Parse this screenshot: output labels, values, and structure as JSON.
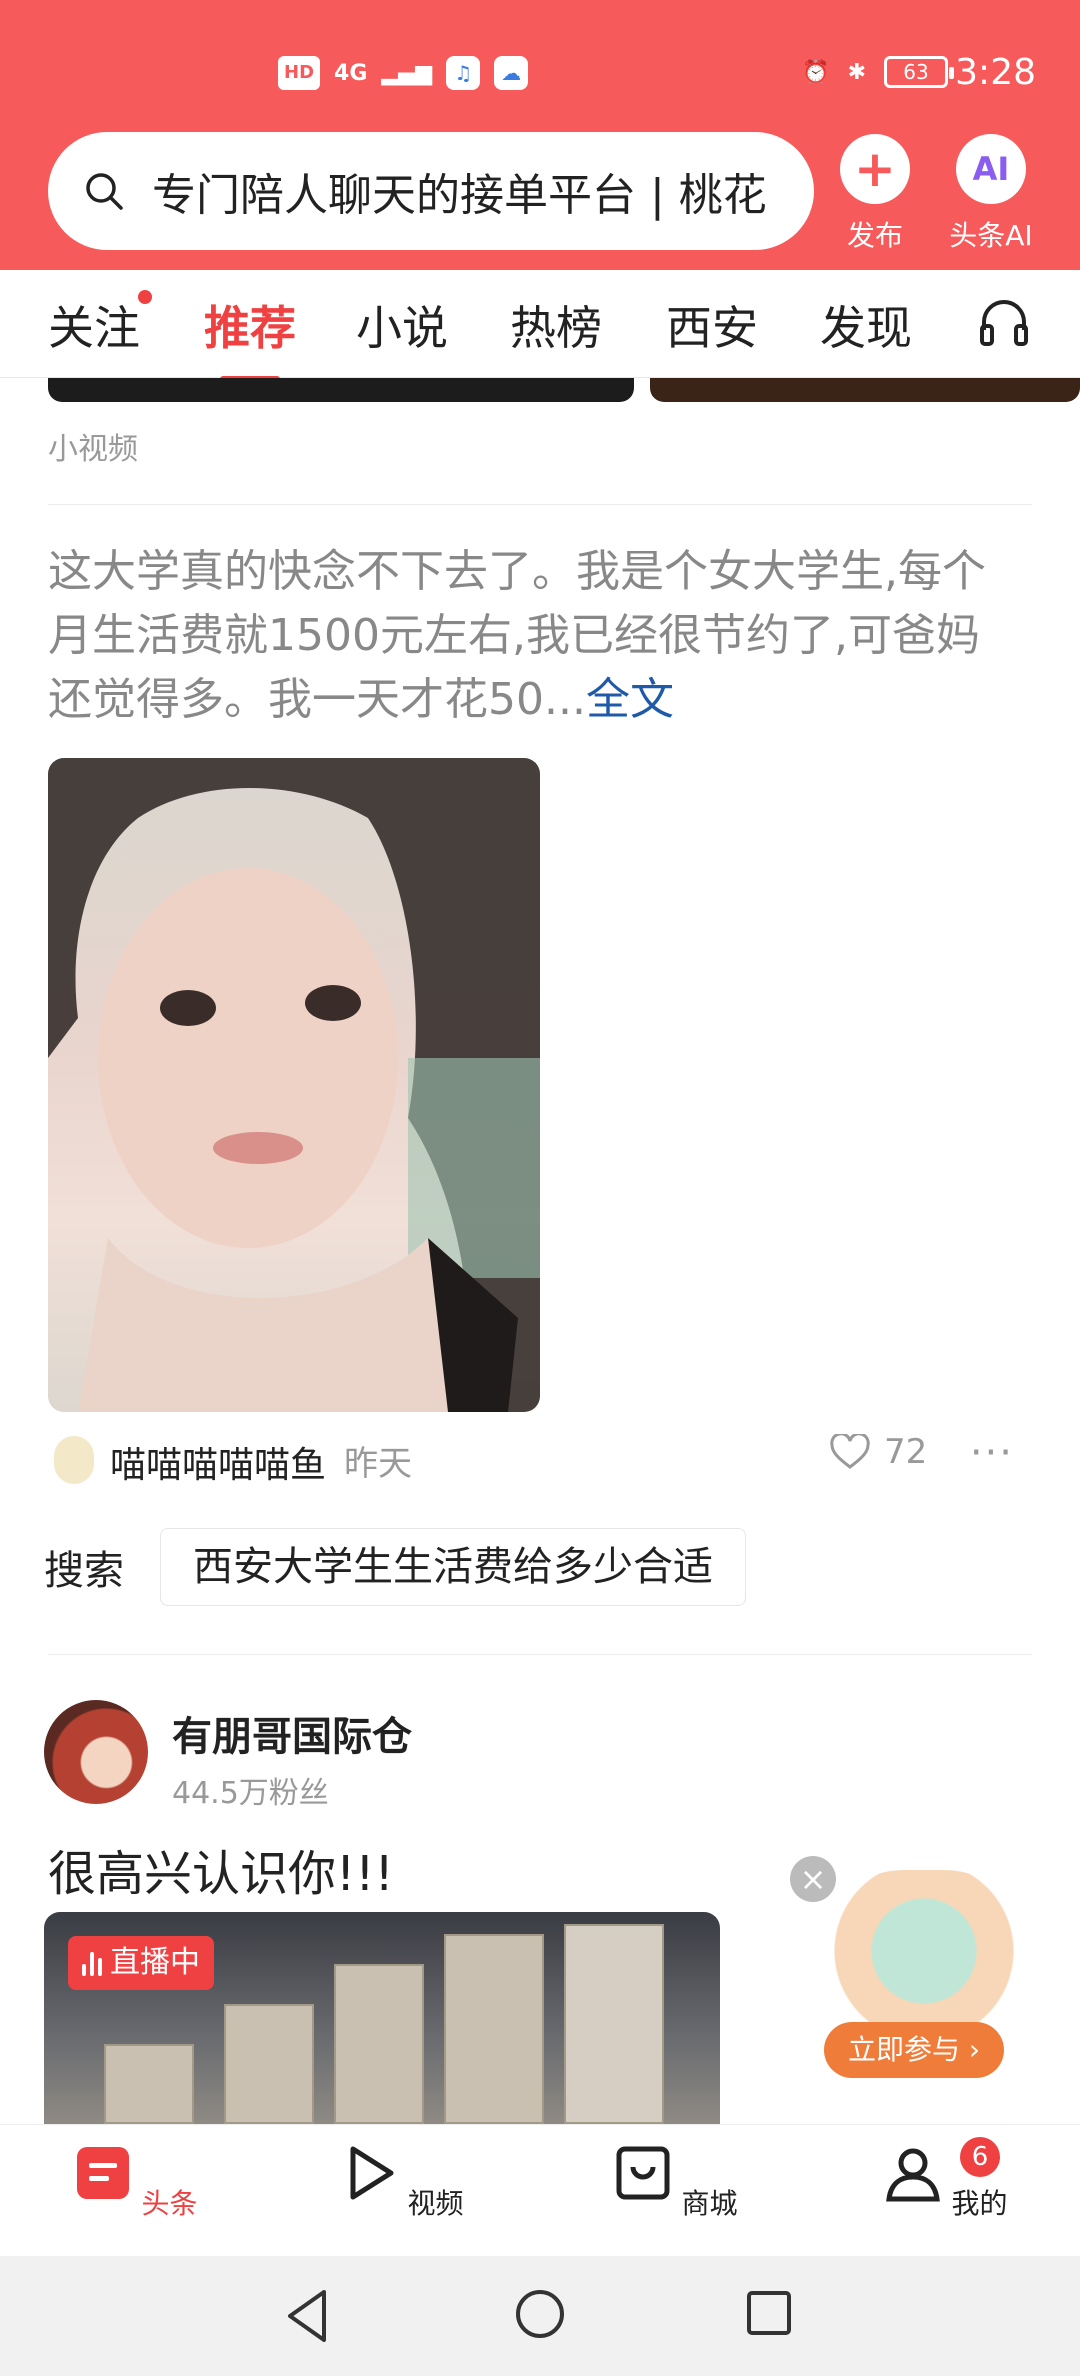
{
  "status_bar": {
    "time": "3:28",
    "battery": "63",
    "network": "4G",
    "hd": "HD"
  },
  "header": {
    "search_query": "专门陪人聊天的接单平台 | 桃花",
    "publish_label": "发布",
    "ai_label": "头条AI",
    "ai_icon_text": "AI"
  },
  "tabs": [
    {
      "label": "关注"
    },
    {
      "label": "推荐"
    },
    {
      "label": "小说"
    },
    {
      "label": "热榜"
    },
    {
      "label": "西安"
    },
    {
      "label": "发现"
    }
  ],
  "feed": {
    "section_label": "小视频",
    "article": {
      "text": "这大学真的快念不下去了。我是个女大学生,每个月生活费就1500元左右,我已经很节约了,可爸妈还觉得多。我一天才花50...",
      "more_label": "全文",
      "author": "喵喵喵喵喵鱼",
      "time": "昨天",
      "likes": "72"
    },
    "search_suggest": {
      "label": "搜索",
      "query": "西安大学生生活费给多少合适"
    },
    "post": {
      "author": "有朋哥国际仓",
      "fans": "44.5万粉丝",
      "title": "很高兴认识你!!!",
      "live_label": "直播中"
    },
    "promo": {
      "cta": "立即参与 ›"
    }
  },
  "bottom_nav": [
    {
      "label": "头条"
    },
    {
      "label": "视频"
    },
    {
      "label": "商城"
    },
    {
      "label": "我的",
      "badge": "6"
    }
  ],
  "colors": {
    "header_bg": "#f65a5a",
    "accent": "#f04142",
    "link": "#1e5aa8"
  }
}
